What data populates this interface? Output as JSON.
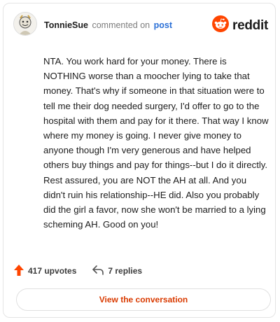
{
  "header": {
    "username": "TonnieSue",
    "verb": "commented on",
    "post_link": "post",
    "logo_word": "reddit"
  },
  "icons": {
    "avatar": "user-avatar",
    "brand": "reddit-alien-logo",
    "upvote": "upvote-arrow-icon",
    "reply": "reply-arrow-icon"
  },
  "colors": {
    "brand": "#ff4500",
    "upvote": "#ff4500",
    "link": "#2a6fd6",
    "button_text": "#d93a00"
  },
  "comment": {
    "text": "NTA. You work hard for your money. There is NOTHING worse than a moocher lying to take that money. That's why if someone in that situation were to tell me their dog needed surgery, I'd offer to go to the hospital with them and pay for it there. That way I know where my money is going. I never give money to anyone though I'm very generous and have helped others buy things and pay for things--but I do it directly. Rest assured, you are NOT the AH at all. And you didn't ruin his relationship--HE did. Also you probably did the girl a favor, now she won't be married to a lying scheming AH. Good on you!"
  },
  "actions": {
    "upvotes": "417 upvotes",
    "replies": "7 replies"
  },
  "view_button": "View the conversation"
}
